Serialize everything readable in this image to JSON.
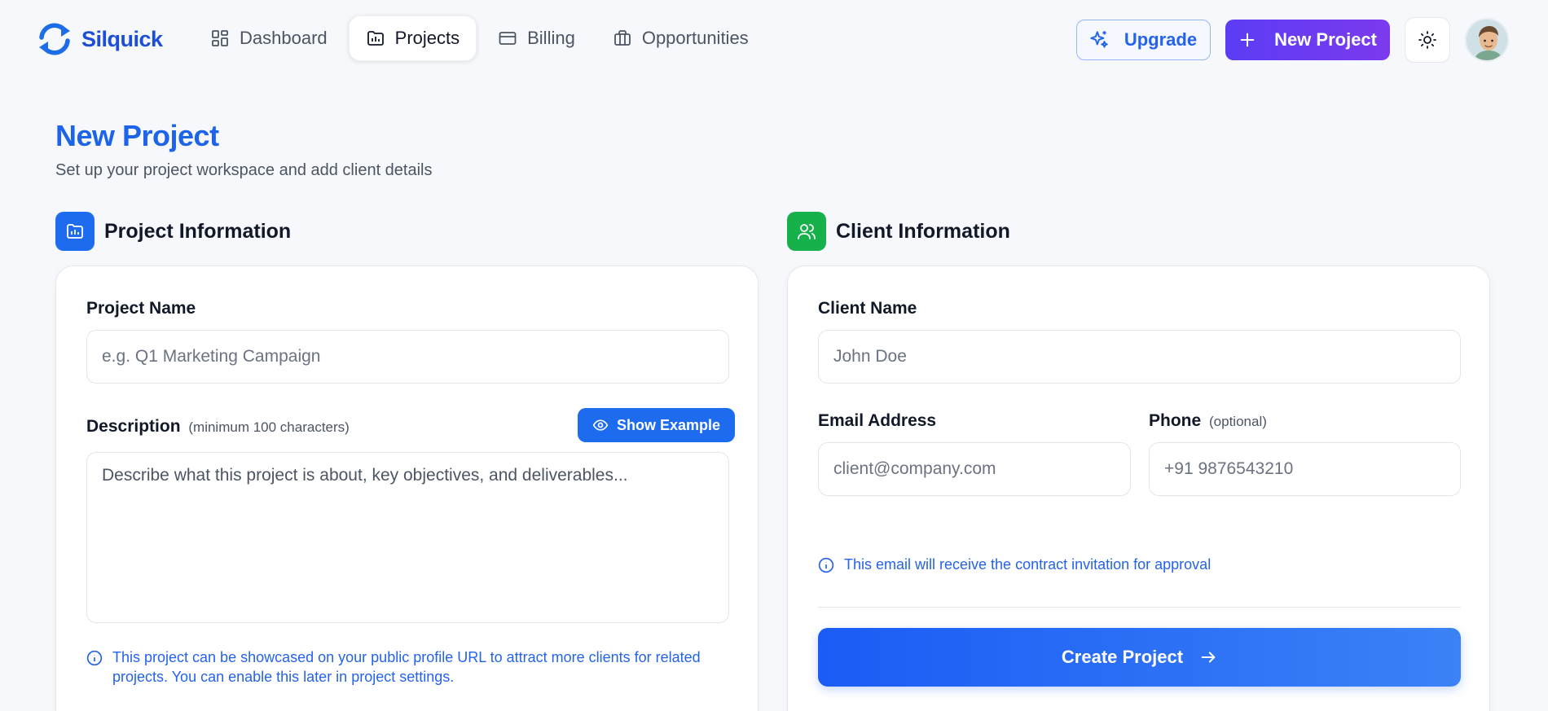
{
  "brand": {
    "name": "Silquick",
    "icon": "sync-logo-icon"
  },
  "nav": {
    "items": [
      {
        "label": "Dashboard",
        "icon": "grid-icon",
        "active": false
      },
      {
        "label": "Projects",
        "icon": "folder-chart-icon",
        "active": true
      },
      {
        "label": "Billing",
        "icon": "credit-card-icon",
        "active": false
      },
      {
        "label": "Opportunities",
        "icon": "briefcase-icon",
        "active": false
      }
    ]
  },
  "actions": {
    "upgrade_label": "Upgrade",
    "new_project_label": "New Project",
    "theme_icon": "sun-icon"
  },
  "page": {
    "title": "New Project",
    "subtitle": "Set up your project workspace and add client details"
  },
  "project_section": {
    "title": "Project Information",
    "name_label": "Project Name",
    "name_placeholder": "e.g. Q1 Marketing Campaign",
    "description_label": "Description",
    "description_hint": "(minimum 100 characters)",
    "show_example_label": "Show Example",
    "description_placeholder": "Describe what this project is about, key objectives, and deliverables...",
    "note": "This project can be showcased on your public profile URL to attract more clients for related projects. You can enable this later in project settings."
  },
  "client_section": {
    "title": "Client Information",
    "client_name_label": "Client Name",
    "client_name_placeholder": "John Doe",
    "email_label": "Email Address",
    "email_placeholder": "client@company.com",
    "phone_label": "Phone",
    "phone_hint": "(optional)",
    "phone_placeholder": "+91 9876543210",
    "note": "This email will receive the contract invitation for approval",
    "create_label": "Create Project"
  },
  "colors": {
    "primary": "#1d64e8",
    "purple": "#6d3cf3",
    "green": "#16b14a",
    "background": "#f6f8fb"
  }
}
